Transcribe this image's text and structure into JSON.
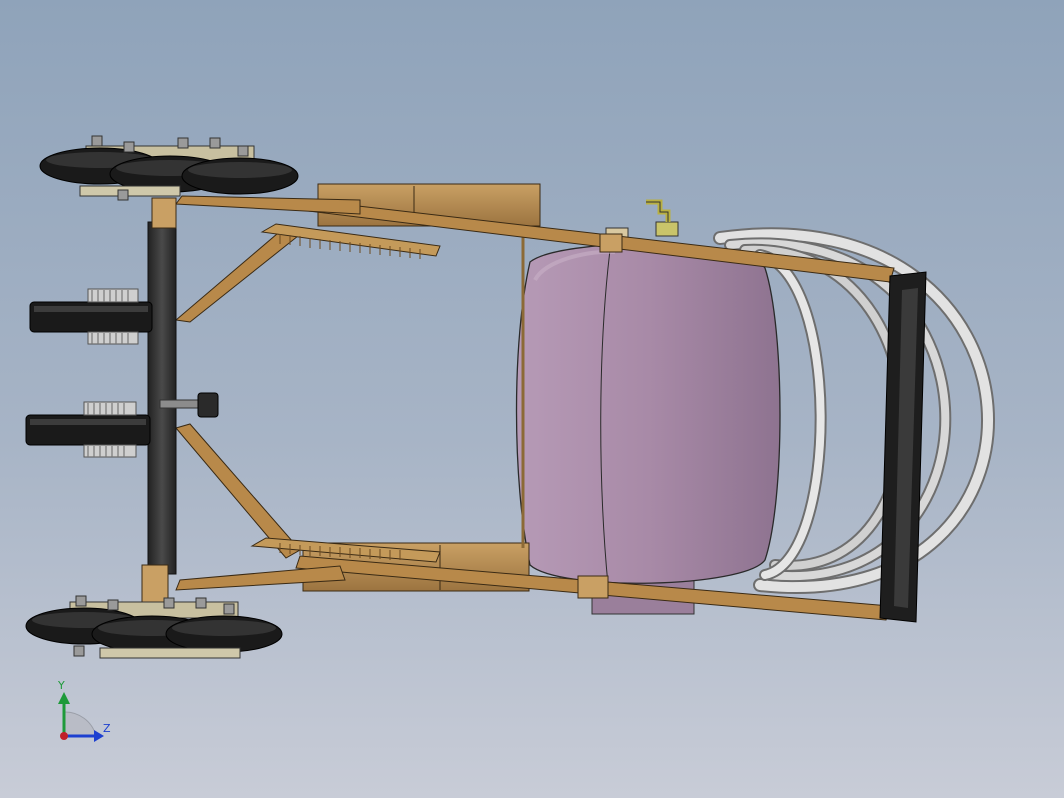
{
  "view": {
    "background_top": "#8fa3ba",
    "background_bottom": "#c8ccd7"
  },
  "model": {
    "frame_color": "#b48a4c",
    "tank_color": "#a98aa8",
    "wheel_color": "#1c1c1c",
    "shaft_color": "#333333",
    "handle_grip_color": "#222222",
    "tube_color": "#d6d6d6"
  },
  "triad": {
    "y_label": "Y",
    "z_label": "Z",
    "y_color": "#1e9a3a",
    "z_color": "#1c3fd0",
    "x_color": "#c0202a"
  }
}
